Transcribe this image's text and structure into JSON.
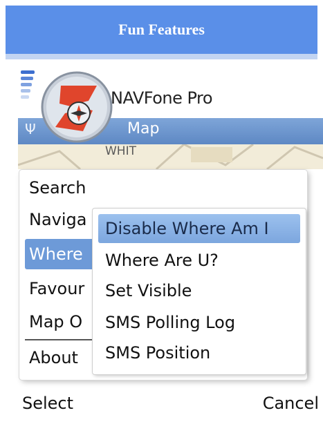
{
  "banner": {
    "title": "Fun Features"
  },
  "app": {
    "title": "NAVFone Pro",
    "tab": "Map",
    "map_label": "WHIT"
  },
  "menu": {
    "items": [
      {
        "label": "Search"
      },
      {
        "label": "Naviga"
      },
      {
        "label": "Where"
      },
      {
        "label": "Favour"
      },
      {
        "label": "Map O"
      },
      {
        "label": "About"
      }
    ],
    "selected_index": 2
  },
  "submenu": {
    "items": [
      {
        "label": "Disable Where Am I"
      },
      {
        "label": "Where Are U?"
      },
      {
        "label": "Set Visible"
      },
      {
        "label": "SMS Polling Log"
      },
      {
        "label": "SMS Position"
      }
    ],
    "selected_index": 0
  },
  "softkeys": {
    "left": "Select",
    "right": "Cancel"
  },
  "colors": {
    "banner": "#5a8fe8",
    "highlight": "#6d9ad8",
    "sub_highlight": "#8fb4e8"
  },
  "icons": {
    "signal": "signal-strength-icon",
    "antenna": "antenna-icon",
    "logo": "navfone-compass-logo-icon"
  }
}
